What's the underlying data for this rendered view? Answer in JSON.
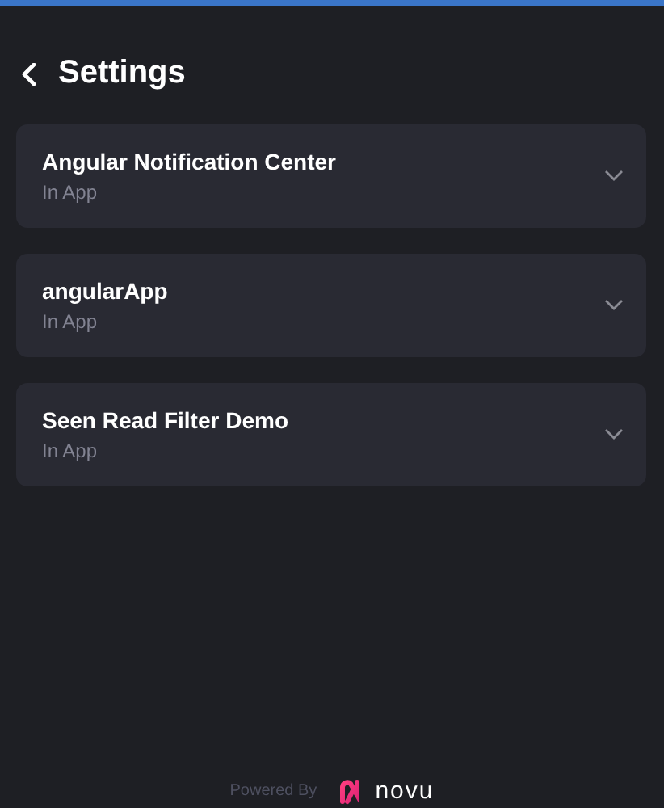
{
  "header": {
    "title": "Settings"
  },
  "items": [
    {
      "title": "Angular Notification Center",
      "subtitle": "In App",
      "expanded": false
    },
    {
      "title": "angularApp",
      "subtitle": "In App",
      "expanded": false
    },
    {
      "title": "Seen Read Filter Demo",
      "subtitle": "In App",
      "expanded": false
    }
  ],
  "footer": {
    "powered_by": "Powered By",
    "brand": "novu"
  }
}
